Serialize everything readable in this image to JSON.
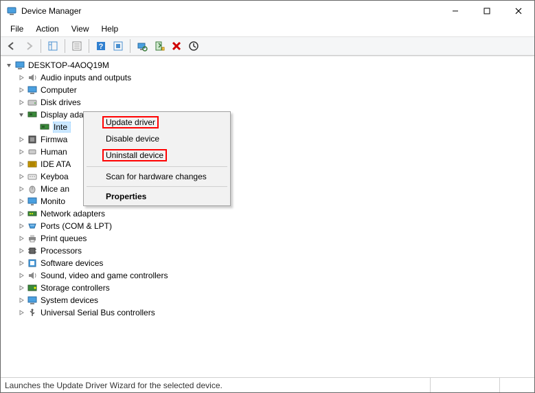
{
  "window": {
    "title": "Device Manager"
  },
  "menubar": [
    "File",
    "Action",
    "View",
    "Help"
  ],
  "tree": {
    "root": {
      "label": "DESKTOP-4AOQ19M",
      "expanded": true
    },
    "items": [
      {
        "label": "Audio inputs and outputs",
        "icon": "audio"
      },
      {
        "label": "Computer",
        "icon": "computer"
      },
      {
        "label": "Disk drives",
        "icon": "disk"
      },
      {
        "label": "Display adapters",
        "icon": "display",
        "expanded": true,
        "children": [
          {
            "label": "Inte",
            "icon": "display",
            "selected": true
          }
        ]
      },
      {
        "label": "Firmwa",
        "icon": "firmware"
      },
      {
        "label": "Human",
        "icon": "hid"
      },
      {
        "label": "IDE ATA",
        "icon": "ide"
      },
      {
        "label": "Keyboa",
        "icon": "keyboard"
      },
      {
        "label": "Mice an",
        "icon": "mouse"
      },
      {
        "label": "Monito",
        "icon": "monitor"
      },
      {
        "label": "Network adapters",
        "icon": "network"
      },
      {
        "label": "Ports (COM & LPT)",
        "icon": "ports"
      },
      {
        "label": "Print queues",
        "icon": "printer"
      },
      {
        "label": "Processors",
        "icon": "cpu"
      },
      {
        "label": "Software devices",
        "icon": "software"
      },
      {
        "label": "Sound, video and game controllers",
        "icon": "sound"
      },
      {
        "label": "Storage controllers",
        "icon": "storage"
      },
      {
        "label": "System devices",
        "icon": "system"
      },
      {
        "label": "Universal Serial Bus controllers",
        "icon": "usb"
      }
    ]
  },
  "context_menu": {
    "items": [
      {
        "label": "Update driver",
        "highlight": true
      },
      {
        "label": "Disable device"
      },
      {
        "label": "Uninstall device",
        "highlight": true
      },
      {
        "separator": true
      },
      {
        "label": "Scan for hardware changes"
      },
      {
        "separator": true
      },
      {
        "label": "Properties",
        "bold": true
      }
    ]
  },
  "statusbar": {
    "text": "Launches the Update Driver Wizard for the selected device."
  }
}
